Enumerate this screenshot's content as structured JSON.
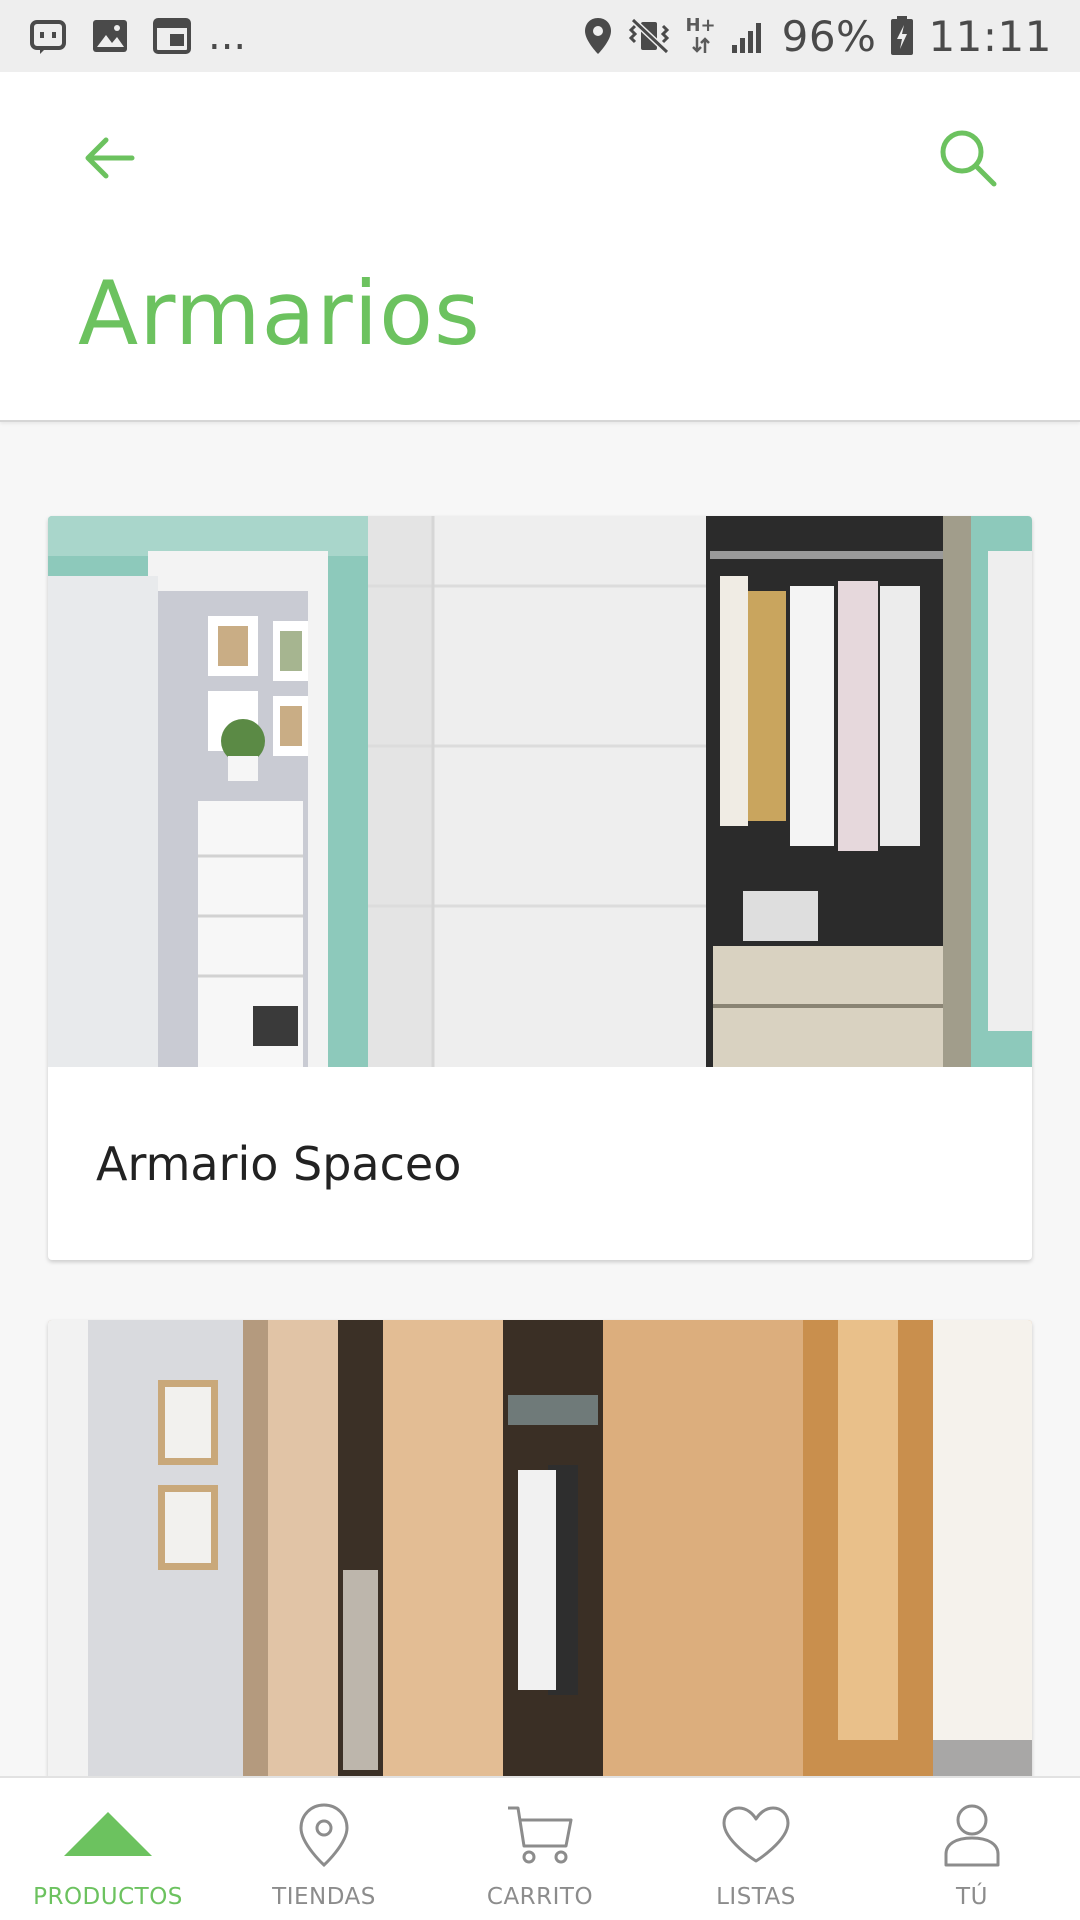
{
  "status_bar": {
    "network_label": "H+",
    "battery": "96%",
    "time": "11:11",
    "overflow": "..."
  },
  "header": {
    "title": "Armarios",
    "back_icon": "arrow-left-icon",
    "search_icon": "search-icon"
  },
  "products": [
    {
      "name": "Armario Spaceo"
    },
    {
      "name": ""
    }
  ],
  "bottom_nav": {
    "items": [
      {
        "label": "PRODUCTOS",
        "icon": "triangle-icon",
        "active": true
      },
      {
        "label": "TIENDAS",
        "icon": "location-pin-icon",
        "active": false
      },
      {
        "label": "CARRITO",
        "icon": "cart-icon",
        "active": false
      },
      {
        "label": "LISTAS",
        "icon": "heart-icon",
        "active": false
      },
      {
        "label": "TÚ",
        "icon": "user-icon",
        "active": false
      }
    ]
  },
  "colors": {
    "accent": "#6cc25f",
    "inactive": "#8c8c8c",
    "status_bar_bg": "#eeeeee"
  }
}
